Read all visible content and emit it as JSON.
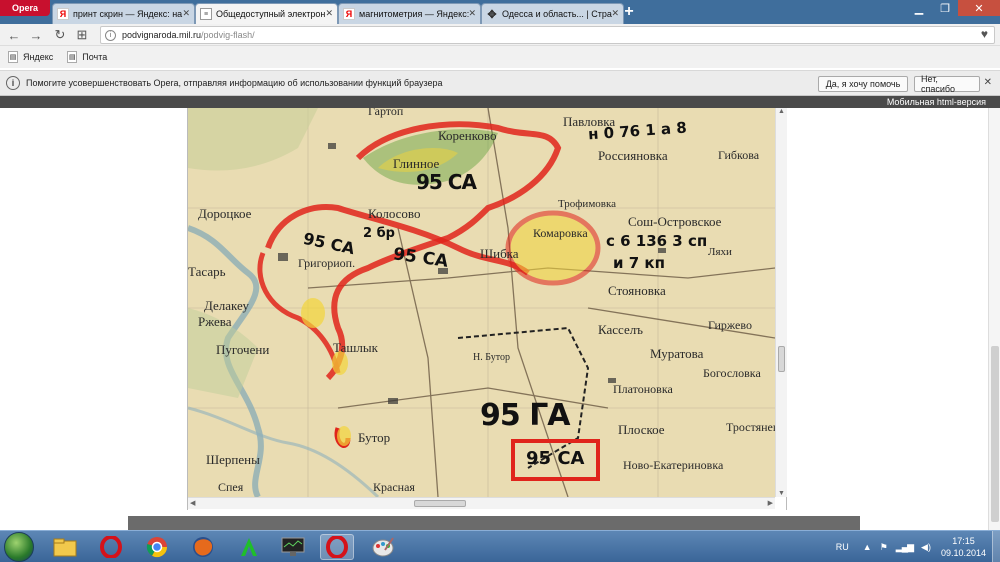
{
  "browser": {
    "menu_label": "Opera",
    "tabs": [
      {
        "title": "принт скрин — Яндекс: на",
        "icon": "yandex-icon",
        "active": false
      },
      {
        "title": "Общедоступный электрон",
        "icon": "document-icon",
        "active": true
      },
      {
        "title": "магнитометрия — Яндекс:",
        "icon": "yandex-icon",
        "active": false
      },
      {
        "title": "Одесса и область... | Стра",
        "icon": "move-icon",
        "active": false
      }
    ],
    "new_tab": "+",
    "url_host": "podvignaroda.mil.ru",
    "url_path": "/podvig-flash/",
    "bookmarks": [
      {
        "label": "Яндекс",
        "icon": "yandex-icon"
      },
      {
        "label": "Почта",
        "icon": "document-icon"
      }
    ],
    "infobar": {
      "message": "Помогите усовершенствовать Opera, отправляя информацию об использовании функций браузера",
      "accept": "Да, я хочу помочь",
      "decline": "Нет, спасибо"
    }
  },
  "site": {
    "mobile_link": "Мобильная html-версия"
  },
  "map": {
    "labels": [
      {
        "text": "Гартоп"
      },
      {
        "text": "Павловка"
      },
      {
        "text": "Коренково"
      },
      {
        "text": "Глинное"
      },
      {
        "text": "Россияновка"
      },
      {
        "text": "Гибкова"
      },
      {
        "text": "Дороцкое"
      },
      {
        "text": "Колосово"
      },
      {
        "text": "Трофимовка"
      },
      {
        "text": "Сош-Островское"
      },
      {
        "text": "Комаровка"
      },
      {
        "text": "Шибка"
      },
      {
        "text": "Стояновка"
      },
      {
        "text": "Григориоп."
      },
      {
        "text": "Тасарь"
      },
      {
        "text": "Делакеу"
      },
      {
        "text": "Ржева"
      },
      {
        "text": "Пугочени"
      },
      {
        "text": "Ташлык"
      },
      {
        "text": "Касселъ"
      },
      {
        "text": "Гиржево"
      },
      {
        "text": "Муратова"
      },
      {
        "text": "Богословка"
      },
      {
        "text": "Платоновка"
      },
      {
        "text": "Плоское"
      },
      {
        "text": "Тростянец"
      },
      {
        "text": "Бутор"
      },
      {
        "text": "Шерпены"
      },
      {
        "text": "Спея"
      },
      {
        "text": "Ново-Екатериновка"
      },
      {
        "text": "Красная"
      },
      {
        "text": "Н. Бутор"
      },
      {
        "text": "Ляхи"
      }
    ],
    "annotations": [
      {
        "text": "95 СА"
      },
      {
        "text": "95 СА"
      },
      {
        "text": "95 СА"
      },
      {
        "text": "95 ГА"
      },
      {
        "text": "95 СА"
      },
      {
        "text": "2 бр"
      },
      {
        "text": "и 7 кп"
      },
      {
        "text": "с 6 136 3 сп"
      },
      {
        "text": "н 0 76 1 а 8"
      }
    ]
  },
  "taskbar": {
    "apps": [
      "explorer-icon",
      "opera-icon",
      "chrome-icon",
      "firefox-icon",
      "green-a-icon",
      "monitor-icon",
      "opera-icon",
      "paint-icon"
    ],
    "lang": "RU",
    "time": "17:15",
    "date": "09.10.2014"
  },
  "colors": {
    "titlebar": "#3f6e9c",
    "map_paper": "#e9dcb2",
    "annotation_red": "#e0241b",
    "annotation_yellow": "#f2d43a",
    "annotation_green": "#5fa03a"
  }
}
